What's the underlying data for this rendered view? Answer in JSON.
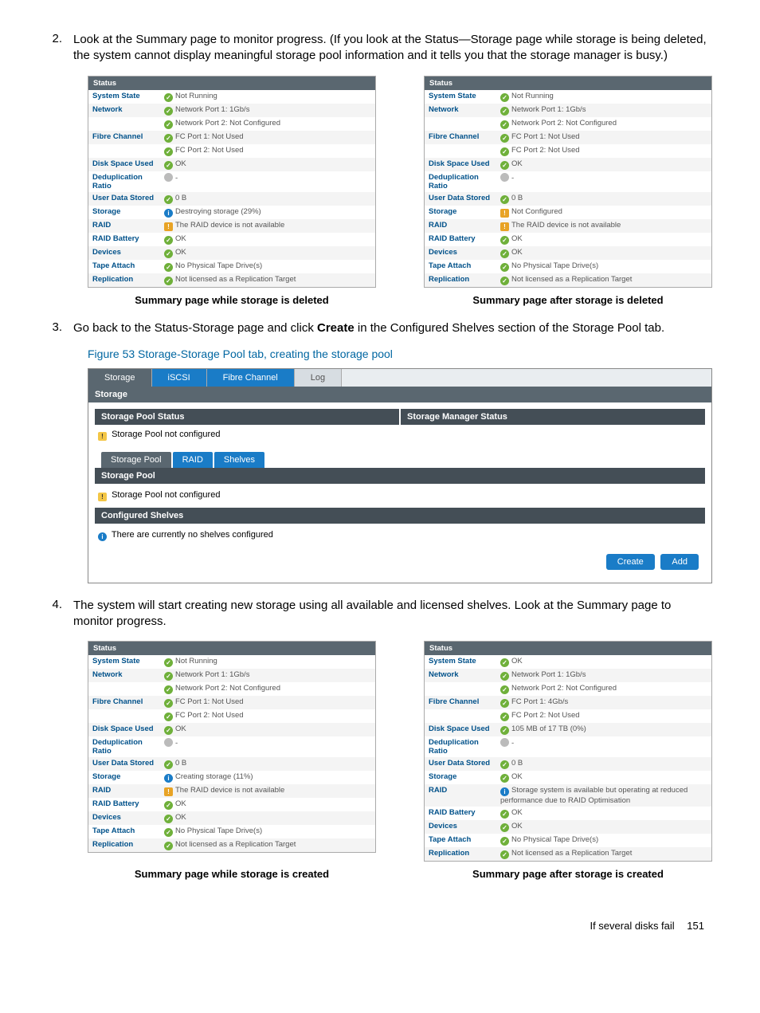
{
  "steps": {
    "s2": {
      "num": "2.",
      "text": "Look at the Summary page to monitor progress. (If you look at the Status—Storage page while storage is being deleted, the system cannot display meaningful storage pool information and it tells you that the storage manager is busy.)"
    },
    "s3": {
      "num": "3.",
      "text_a": "Go back to the Status-Storage page and click ",
      "bold": "Create",
      "text_b": " in the Configured Shelves section of the Storage Pool tab."
    },
    "s4": {
      "num": "4.",
      "text": "The system will start creating new storage using all available and licensed shelves. Look at the Summary page to monitor progress."
    }
  },
  "captions": {
    "c1a": "Summary page while storage is deleted",
    "c1b": "Summary page after storage is deleted",
    "c2a": "Summary page while storage is created",
    "c2b": "Summary page after storage is created",
    "fig53": "Figure 53 Storage-Storage Pool tab, creating the storage pool"
  },
  "status_labels": {
    "status": "Status",
    "system_state": "System State",
    "network": "Network",
    "fibre_channel": "Fibre Channel",
    "disk_space_used": "Disk Space Used",
    "dedup_ratio": "Deduplication Ratio",
    "user_data_stored": "User Data Stored",
    "storage": "Storage",
    "raid": "RAID",
    "raid_battery": "RAID Battery",
    "devices": "Devices",
    "tape_attach": "Tape Attach",
    "replication": "Replication"
  },
  "panel1": {
    "system_state": "Not Running",
    "net1": "Network Port 1: 1Gb/s",
    "net2": "Network Port 2: Not Configured",
    "fc1": "FC Port 1: Not Used",
    "fc2": "FC Port 2: Not Used",
    "disk": "OK",
    "dedup": "-",
    "uds": "0 B",
    "storage": "Destroying storage (29%)",
    "raid": "The RAID device is not available",
    "battery": "OK",
    "devices": "OK",
    "tape": "No Physical Tape Drive(s)",
    "repl": "Not licensed as a Replication Target"
  },
  "panel2": {
    "system_state": "Not Running",
    "net1": "Network Port 1: 1Gb/s",
    "net2": "Network Port 2: Not Configured",
    "fc1": "FC Port 1: Not Used",
    "fc2": "FC Port 2: Not Used",
    "disk": "OK",
    "dedup": "-",
    "uds": "0 B",
    "storage": "Not Configured",
    "raid": "The RAID device is not available",
    "battery": "OK",
    "devices": "OK",
    "tape": "No Physical Tape Drive(s)",
    "repl": "Not licensed as a Replication Target"
  },
  "panel3": {
    "system_state": "Not Running",
    "net1": "Network Port 1: 1Gb/s",
    "net2": "Network Port 2: Not Configured",
    "fc1": "FC Port 1: Not Used",
    "fc2": "FC Port 2: Not Used",
    "disk": "OK",
    "dedup": "-",
    "uds": "0 B",
    "storage": "Creating storage (11%)",
    "raid": "The RAID device is not available",
    "battery": "OK",
    "devices": "OK",
    "tape": "No Physical Tape Drive(s)",
    "repl": "Not licensed as a Replication Target"
  },
  "panel4": {
    "system_state": "OK",
    "net1": "Network Port 1: 1Gb/s",
    "net2": "Network Port 2: Not Configured",
    "fc1": "FC Port 1: 4Gb/s",
    "fc2": "FC Port 2: Not Used",
    "disk": "105 MB of 17 TB (0%)",
    "dedup": "-",
    "uds": "0 B",
    "storage": "OK",
    "raid": "Storage system is available but operating at reduced performance due to RAID Optimisation",
    "battery": "OK",
    "devices": "OK",
    "tape": "No Physical Tape Drive(s)",
    "repl": "Not licensed as a Replication Target"
  },
  "fig53": {
    "tabs": {
      "storage": "Storage",
      "iscsi": "iSCSI",
      "fc": "Fibre Channel",
      "log": "Log"
    },
    "bar_storage": "Storage",
    "status_pool": "Storage Pool Status",
    "status_mgr": "Storage Manager Status",
    "msg_not_conf": "Storage Pool not configured",
    "subtabs": {
      "pool": "Storage Pool",
      "raid": "RAID",
      "shelves": "Shelves"
    },
    "bar_pool": "Storage Pool",
    "bar_shelves": "Configured Shelves",
    "msg_no_shelves": "There are currently no shelves configured",
    "btn_create": "Create",
    "btn_add": "Add"
  },
  "footer": {
    "section": "If several disks fail",
    "page": "151"
  }
}
